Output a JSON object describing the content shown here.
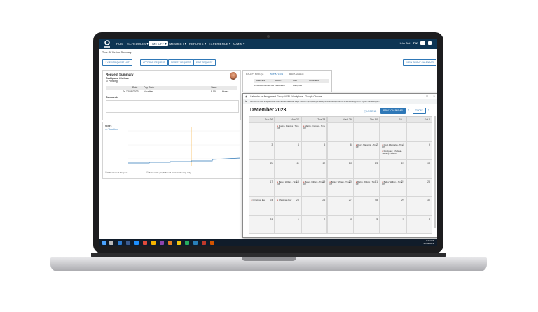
{
  "nav": {
    "items": [
      "HUB",
      "SCHEDULES ▾",
      "TIME OFF ▾",
      "TIMESHEET ▾",
      "REPORTS ▾",
      "EXPERIENCE ▾",
      "ADMIN ▾"
    ],
    "active_index": 2,
    "user_label": "Hello Ted",
    "user_initials": "TW"
  },
  "page": {
    "subtitle": "Time Off Review Summary",
    "buttons": [
      "+ VIEW REQUEST LIST",
      "APPROVE REQUEST",
      "REJECT REQUEST",
      "EDIT REQUEST"
    ],
    "group_calendar_button": "VIEW GROUP CALENDAR"
  },
  "request": {
    "title": "Request Summary",
    "employee": "Rodriguez, Chelsea",
    "status": "Pending",
    "table_headers": [
      "Date",
      "Pay Code",
      "Value"
    ],
    "row": {
      "date": "Fri 12/08/2023",
      "pay_code": "Vacation",
      "value": "8.00",
      "unit": "Hours"
    },
    "comments_label": "Comments"
  },
  "chart": {
    "title": "Hours",
    "legend": "Vacation",
    "checkbox1": "With Current Request",
    "checkbox2": "Auto-scale graph based on current entry only"
  },
  "exceptions": {
    "tabs": [
      "EXCEPTIONS (0)",
      "WORKFLOW",
      "BANK USAGE"
    ],
    "headers": [
      "Date/Time",
      "Action",
      "User",
      "Comments"
    ],
    "row": [
      "11/16/2023 11:32 AM",
      "Submitted",
      "Weill, Ted",
      ""
    ]
  },
  "popup": {
    "title": "Calendar for Assignment Group WSPU Workplace - Google Chrome",
    "url": "demo-info.tide.eclipsecloud.com/tcore/Calendar.aspx?action=group&type=assignment&assignment=12345&AssignmentType=3&viewtype=",
    "month": "December 2023",
    "legend_btn": "LEGEND",
    "print_btn": "PRINT CALENDAR",
    "today_btn": "TODAY",
    "weekdays": [
      "Sun 26",
      "Mon 27",
      "Tue 28",
      "Wed 29",
      "Thu 30",
      "Fri 1",
      "Sat 2"
    ],
    "weeks": [
      [
        {
          "d": ""
        },
        {
          "d": ""
        },
        {
          "d": ""
        },
        {
          "d": ""
        },
        {
          "d": ""
        },
        {
          "d": ""
        },
        {
          "d": ""
        }
      ],
      [
        {
          "d": "3"
        },
        {
          "d": "4"
        },
        {
          "d": "5"
        },
        {
          "d": "6"
        },
        {
          "d": "7"
        },
        {
          "d": "8"
        },
        {
          "d": "9"
        }
      ],
      [
        {
          "d": "10"
        },
        {
          "d": "11"
        },
        {
          "d": "12"
        },
        {
          "d": "13"
        },
        {
          "d": "14"
        },
        {
          "d": "15"
        },
        {
          "d": "16"
        }
      ],
      [
        {
          "d": "17"
        },
        {
          "d": "18"
        },
        {
          "d": "19"
        },
        {
          "d": "20"
        },
        {
          "d": "21"
        },
        {
          "d": "22"
        },
        {
          "d": "23"
        }
      ],
      [
        {
          "d": "24"
        },
        {
          "d": "25"
        },
        {
          "d": "26"
        },
        {
          "d": "27"
        },
        {
          "d": "28"
        },
        {
          "d": "29"
        },
        {
          "d": "30"
        }
      ],
      [
        {
          "d": "31"
        },
        {
          "d": "1"
        },
        {
          "d": "2"
        },
        {
          "d": "3"
        },
        {
          "d": "4"
        },
        {
          "d": "5"
        },
        {
          "d": "6"
        }
      ]
    ],
    "events": {
      "0-1": "Marino, Frances - Time Off",
      "0-2": "Marino, Frances - Time Off",
      "1-4": "Dooz, Margarita - Time Off",
      "1-5": "Dooz, Margarita - Time Off",
      "1-5b": "Rodriguez, Chelsea - Pending Time Off",
      "3-1": "Bailey, William - Time Off",
      "3-2": "Bailey, William - Time Off",
      "3-3": "Bailey, William - Time Off",
      "3-4": "Bailey, William - Time Off",
      "3-5": "Bailey, William - Time Off",
      "4-0": "Christmas Eve",
      "4-1": "Christmas Day"
    }
  },
  "taskbar": {
    "time": "4:25 PM",
    "date": "11/16/2023"
  },
  "colors": {
    "navbar": "#0d3554",
    "accent": "#2f78b7",
    "event_dot": "#c0392b"
  }
}
